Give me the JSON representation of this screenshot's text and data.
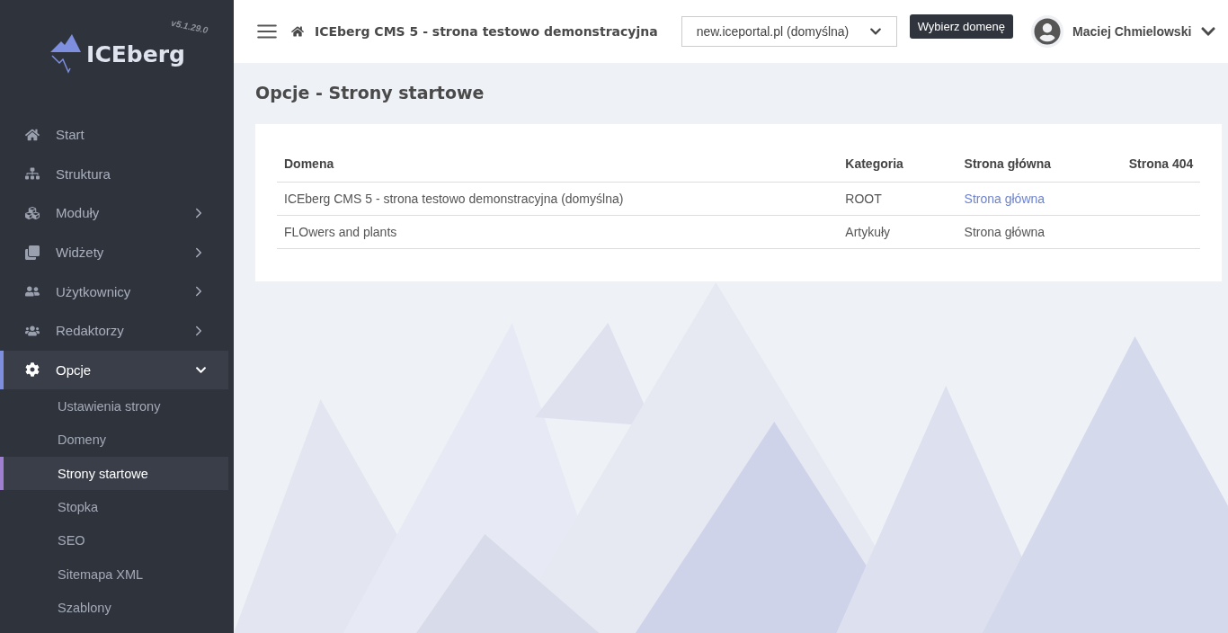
{
  "sidebar": {
    "logo": "ICEberg",
    "version": "v5.1.29.0",
    "items": [
      {
        "label": "Start",
        "selected": false,
        "expandable": false,
        "expanded": false
      },
      {
        "label": "Struktura",
        "selected": false,
        "expandable": false,
        "expanded": false
      },
      {
        "label": "Moduły",
        "selected": false,
        "expandable": true,
        "expanded": false
      },
      {
        "label": "Widżety",
        "selected": false,
        "expandable": true,
        "expanded": false
      },
      {
        "label": "Użytkownicy",
        "selected": false,
        "expandable": true,
        "expanded": false
      },
      {
        "label": "Redaktorzy",
        "selected": false,
        "expandable": true,
        "expanded": false
      },
      {
        "label": "Opcje",
        "selected": true,
        "expandable": true,
        "expanded": true,
        "children": [
          {
            "label": "Ustawienia strony",
            "selected": false
          },
          {
            "label": "Domeny",
            "selected": false
          },
          {
            "label": "Strony startowe",
            "selected": true
          },
          {
            "label": "Stopka",
            "selected": false
          },
          {
            "label": "SEO",
            "selected": false
          },
          {
            "label": "Sitemapa XML",
            "selected": false
          },
          {
            "label": "Szablony",
            "selected": false
          }
        ]
      }
    ]
  },
  "header": {
    "site_title": "ICEberg CMS 5 - strona testowo demonstracyjna",
    "domain_select": "new.iceportal.pl (domyślna)",
    "tooltip": "Wybierz domenę",
    "user": "Maciej Chmielowski"
  },
  "page_title": "Opcje - Strony startowe",
  "table": {
    "columns": [
      "Domena",
      "Kategoria",
      "Strona główna",
      "Strona 404"
    ],
    "rows": [
      [
        {
          "text": "ICEberg CMS 5 - strona testowo demonstracyjna (domyślna)",
          "link": false
        },
        {
          "text": "ROOT",
          "link": false
        },
        {
          "text": "Strona główna",
          "link": true
        }
      ],
      [
        {
          "text": "FLOwers and plants",
          "link": false
        },
        {
          "text": "Artykuły",
          "link": false
        },
        {
          "text": "Strona główna",
          "link": false
        }
      ]
    ]
  }
}
